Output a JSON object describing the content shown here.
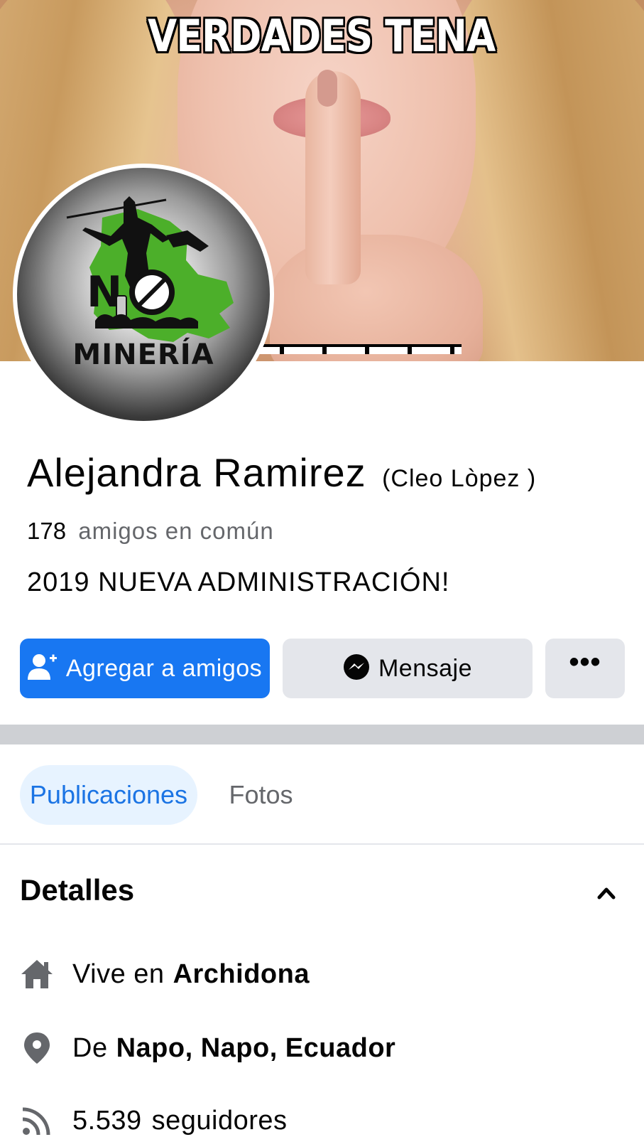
{
  "cover": {
    "title": "VERDADES TENA",
    "image": "woman-shushing-photo"
  },
  "avatar": {
    "text": "MINERÍA",
    "badge": "NO",
    "colors": {
      "map": "#4caf2a",
      "ring": "#ffffff"
    }
  },
  "profile": {
    "name": "Alejandra Ramirez",
    "alternate_name": "(Cleo Lòpez )",
    "mutual_count": "178",
    "mutual_label": "amigos en común",
    "bio": "2019 NUEVA ADMINISTRACIÓN!"
  },
  "actions": {
    "add_friend": "Agregar a amigos",
    "message": "Mensaje",
    "more": "•••"
  },
  "tabs": [
    {
      "label": "Publicaciones",
      "active": true
    },
    {
      "label": "Fotos",
      "active": false
    }
  ],
  "details": {
    "title": "Detalles",
    "lives_prefix": "Vive en",
    "lives_place": "Archidona",
    "from_prefix": "De",
    "from_place": "Napo, Napo, Ecuador",
    "followers_count": "5.539",
    "followers_label": "seguidores"
  },
  "colors": {
    "primary": "#1877f2",
    "secondary_button": "#e4e6eb",
    "active_tab_bg": "#e7f3ff",
    "active_tab_text": "#1b74e4",
    "muted_text": "#65676b",
    "divider": "#ced0d4"
  },
  "icons": {
    "add_friend": "person-add-icon",
    "message": "messenger-icon",
    "chevron": "chevron-up-icon",
    "lives": "home-icon",
    "from": "location-pin-icon",
    "followers": "rss-feed-icon"
  }
}
